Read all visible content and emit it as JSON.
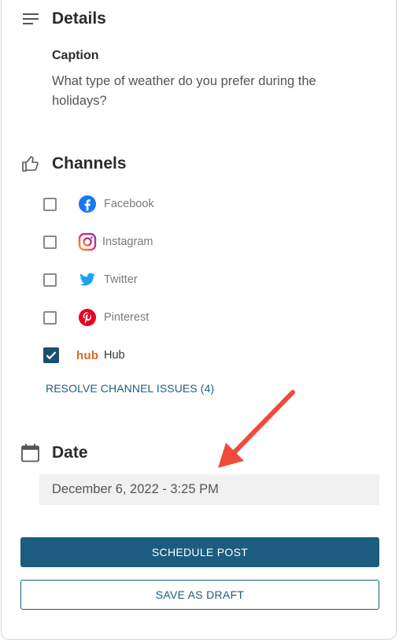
{
  "details": {
    "title": "Details",
    "caption_label": "Caption",
    "caption_text": "What type of weather do you prefer during the holidays?"
  },
  "channels": {
    "title": "Channels",
    "items": [
      {
        "label": "Facebook",
        "checked": false,
        "icon": "facebook-icon"
      },
      {
        "label": "Instagram",
        "checked": false,
        "icon": "instagram-icon"
      },
      {
        "label": "Twitter",
        "checked": false,
        "icon": "twitter-icon"
      },
      {
        "label": "Pinterest",
        "checked": false,
        "icon": "pinterest-icon"
      },
      {
        "label": "Hub",
        "checked": true,
        "icon": "hub-logo",
        "logo_text": "hub"
      }
    ],
    "resolve_link": "RESOLVE CHANNEL ISSUES (4)"
  },
  "date": {
    "title": "Date",
    "value": "December 6, 2022 - 3:25 PM"
  },
  "actions": {
    "schedule_label": "SCHEDULE POST",
    "draft_label": "SAVE AS DRAFT"
  },
  "colors": {
    "primary": "#1c5c7e",
    "checkbox_checked": "#1a4f6e",
    "annotation_arrow": "#ef4a3c",
    "facebook": "#1877f2",
    "twitter": "#1da1f2",
    "pinterest": "#e60023",
    "hub": "#e0641e"
  }
}
